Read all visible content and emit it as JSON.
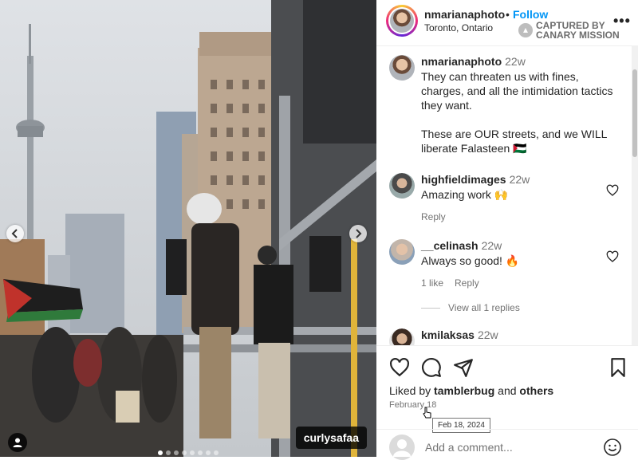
{
  "post": {
    "photo_tag": "curlysafaa",
    "carousel_count": 8,
    "carousel_active": 1
  },
  "header": {
    "username": "nmarianaphoto",
    "separator": "•",
    "follow_label": "Follow",
    "location": "Toronto, Ontario",
    "watermark_line1": "CAPTURED BY",
    "watermark_line2": "CANARY MISSION",
    "more_label": "•••"
  },
  "caption": {
    "username": "nmarianaphoto",
    "time": "22w",
    "text": "They can threaten us with fines, charges, and all the intimidation tactics they want.\n\nThese are OUR streets, and we WILL liberate Falasteen 🇵🇸"
  },
  "comments": [
    {
      "username": "highfieldimages",
      "time": "22w",
      "text": "Amazing work 🙌",
      "reply_label": "Reply"
    },
    {
      "username": "__celinash",
      "time": "22w",
      "text": "Always so good! 🔥",
      "likes_label": "1 like",
      "reply_label": "Reply"
    },
    {
      "username": "kmilaksas",
      "time": "22w"
    }
  ],
  "view_replies_label": "View all 1 replies",
  "likes": {
    "prefix": "Liked by ",
    "user": "tamblerbug",
    "middle": " and ",
    "others": "others"
  },
  "date": "February 18",
  "tooltip": "Feb 18, 2024",
  "add_comment_placeholder": "Add a comment..."
}
